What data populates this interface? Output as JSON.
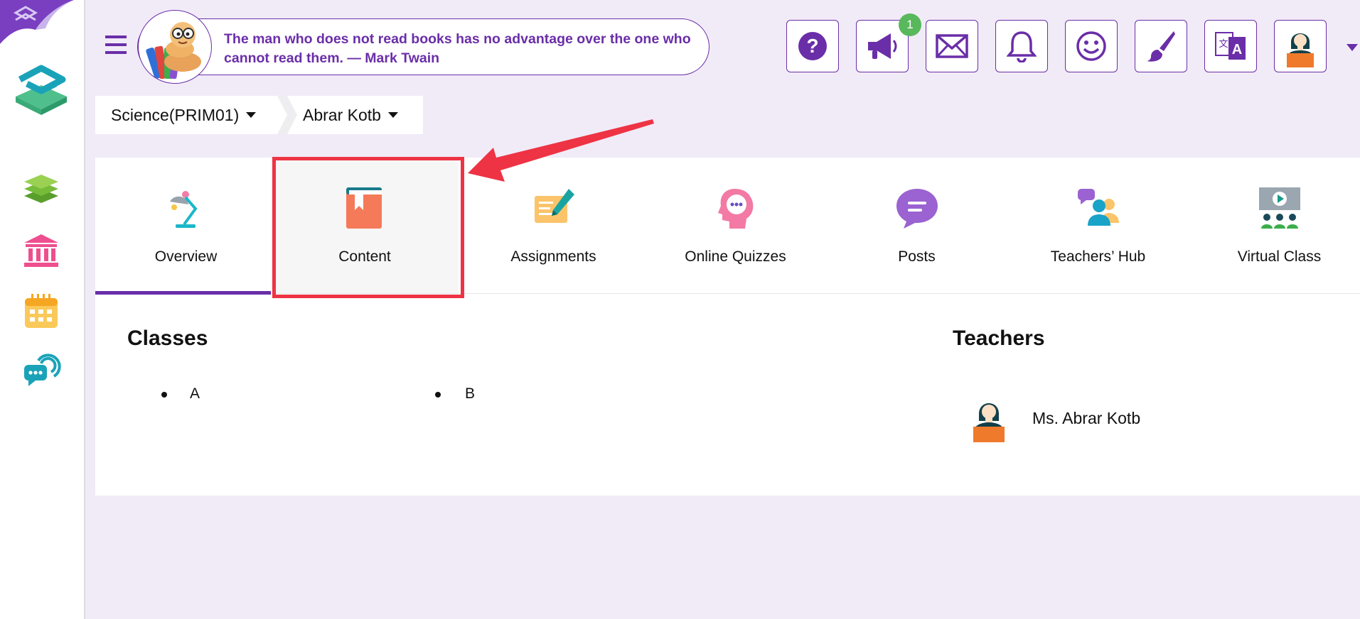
{
  "header": {
    "quote": "The man who does not read books has no advantage over the one who cannot read them. — Mark Twain",
    "notification_count": "1",
    "icons": [
      "help-icon",
      "megaphone-icon",
      "mail-icon",
      "bell-icon",
      "smiley-icon",
      "brush-icon",
      "translate-icon",
      "user-avatar"
    ]
  },
  "breadcrumb": {
    "course": "Science(PRIM01)",
    "teacher": "Abrar Kotb"
  },
  "tabs": [
    {
      "label": "Overview",
      "icon": "desk-lamp-icon",
      "active": true
    },
    {
      "label": "Content",
      "icon": "book-icon",
      "highlighted": true
    },
    {
      "label": "Assignments",
      "icon": "pen-paper-icon"
    },
    {
      "label": "Online Quizzes",
      "icon": "head-chat-icon"
    },
    {
      "label": "Posts",
      "icon": "chat-bubble-icon"
    },
    {
      "label": "Teachers’ Hub",
      "icon": "teachers-group-icon"
    },
    {
      "label": "Virtual Class",
      "icon": "virtual-class-icon"
    }
  ],
  "overview": {
    "classes_title": "Classes",
    "classes": [
      "A",
      "B"
    ],
    "teachers_title": "Teachers",
    "teachers": [
      "Ms. Abrar Kotb"
    ]
  },
  "colors": {
    "brand_purple": "#6a2ea8",
    "background": "#f1ebf8",
    "highlight_red": "#ee3344",
    "badge_green": "#59b85c"
  }
}
